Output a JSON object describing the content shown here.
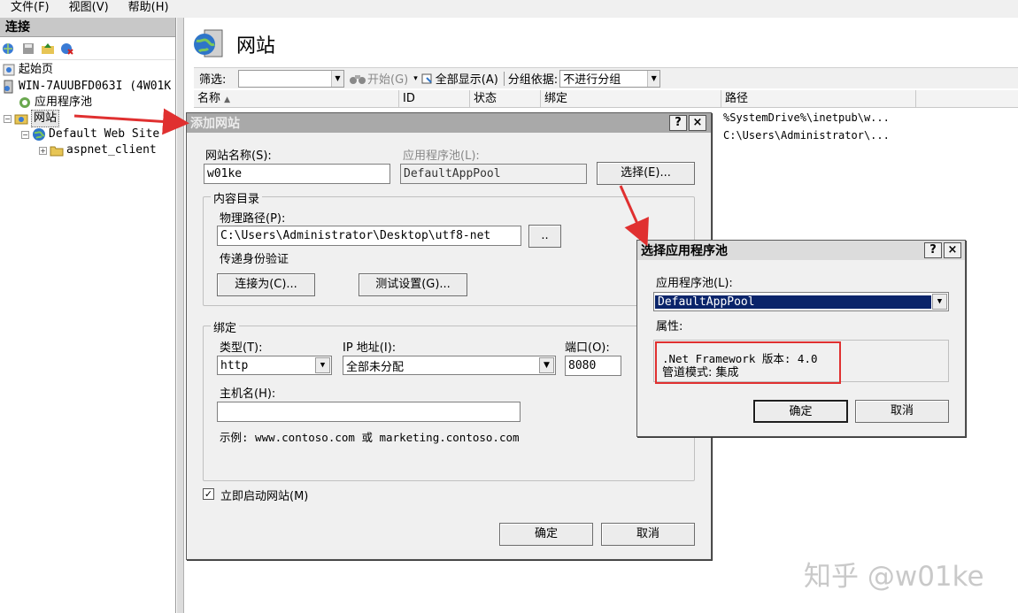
{
  "menu": [
    "文件(F)",
    "视图(V)",
    "帮助(H)"
  ],
  "connections": {
    "title": "连接",
    "tree": [
      {
        "label": "起始页"
      },
      {
        "label": "WIN-7AUUBFD063I (4W01K"
      },
      {
        "label": "应用程序池"
      },
      {
        "label": "网站"
      },
      {
        "label": "Default Web Site"
      },
      {
        "label": "aspnet_client"
      }
    ]
  },
  "main": {
    "title": "网站",
    "filter_label": "筛选:",
    "start_label": "开始(G)",
    "show_all_label": "全部显示(A)",
    "group_by_label": "分组依据:",
    "group_by_value": "不进行分组",
    "columns": [
      "名称",
      "ID",
      "状态",
      "绑定",
      "路径"
    ],
    "rows": [
      {
        "path": "%SystemDrive%\\inetpub\\w..."
      },
      {
        "path": "C:\\Users\\Administrator\\..."
      }
    ]
  },
  "add_site": {
    "title": "添加网站",
    "site_name_label": "网站名称(S):",
    "site_name_value": "w01ke",
    "app_pool_label": "应用程序池(L):",
    "app_pool_value": "DefaultAppPool",
    "select_button": "选择(E)...",
    "content_dir_group": "内容目录",
    "physical_path_label": "物理路径(P):",
    "physical_path_value": "C:\\Users\\Administrator\\Desktop\\utf8-net",
    "browse_button": "..",
    "pass_through_label": "传递身份验证",
    "connect_as_button": "连接为(C)...",
    "test_settings_button": "测试设置(G)...",
    "binding_group": "绑定",
    "type_label": "类型(T):",
    "type_value": "http",
    "ip_label": "IP 地址(I):",
    "ip_value": "全部未分配",
    "port_label": "端口(O):",
    "port_value": "8080",
    "host_label": "主机名(H):",
    "host_value": "",
    "example_text": "示例: www.contoso.com 或 marketing.contoso.com",
    "start_now_label": "立即启动网站(M)",
    "start_now_checked": true,
    "ok_button": "确定",
    "cancel_button": "取消"
  },
  "select_pool": {
    "title": "选择应用程序池",
    "pool_label": "应用程序池(L):",
    "pool_value": "DefaultAppPool",
    "properties_label": "属性:",
    "framework_text": ".Net Framework 版本: 4.0",
    "pipeline_text": "管道模式: 集成",
    "ok_button": "确定",
    "cancel_button": "取消"
  },
  "titlebar_buttons": {
    "help": "?",
    "close": "×"
  },
  "watermark": "知乎 @w01ke",
  "colors": {
    "highlight_box": "#e03030",
    "arrow": "#e03030",
    "selection": "#0a246a"
  }
}
